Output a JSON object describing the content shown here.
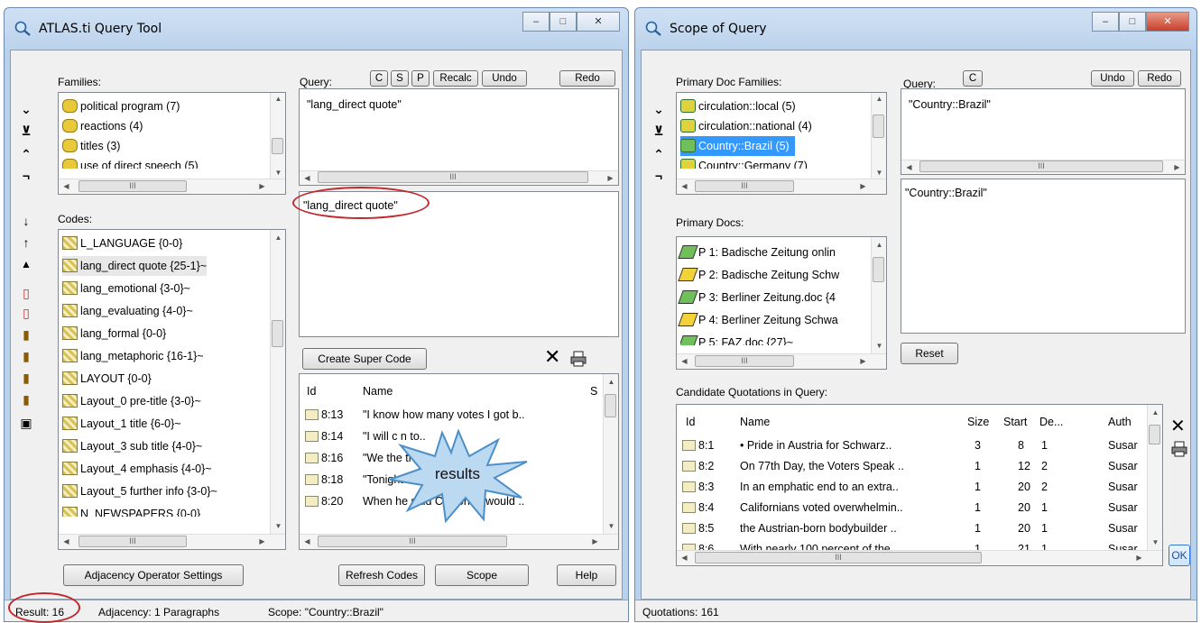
{
  "left_window": {
    "title": "ATLAS.ti Query Tool",
    "families_label": "Families:",
    "families": [
      "political program (7)",
      "reactions (4)",
      "titles (3)",
      "use of direct speech (5)"
    ],
    "codes_label": "Codes:",
    "codes": [
      "L_LANGUAGE {0-0}",
      "lang_direct quote {25-1}~",
      "lang_emotional {3-0}~",
      "lang_evaluating {4-0}~",
      "lang_formal {0-0}",
      "lang_metaphoric {16-1}~",
      "LAYOUT {0-0}",
      "Layout_0 pre-title {3-0}~",
      "Layout_1 title {6-0}~",
      "Layout_3 sub title {4-0}~",
      "Layout_4 emphasis {4-0}~",
      "Layout_5 further info {3-0}~",
      "N_NEWSPAPERS {0-0}"
    ],
    "query_label": "Query:",
    "query_buttons": [
      "C",
      "S",
      "P",
      "Recalc",
      "Undo",
      "Redo"
    ],
    "query_text": "\"lang_direct quote\"",
    "query_stack_text": "\"lang_direct quote\"",
    "create_super_code": "Create Super Code",
    "results_columns": [
      "Id",
      "Name",
      "S"
    ],
    "results": [
      {
        "id": "8:13",
        "name": "\"I know how many votes I got b.."
      },
      {
        "id": "8:14",
        "name": "\"I will c                      n to.."
      },
      {
        "id": "8:16",
        "name": "\"We                          the tru.."
      },
      {
        "id": "8:18",
        "name": "\"Tonight t               ecided it.."
      },
      {
        "id": "8:20",
        "name": "When he said California would .."
      }
    ],
    "callout": "results",
    "buttons": {
      "adjacency": "Adjacency Operator Settings",
      "refresh": "Refresh Codes",
      "scope": "Scope",
      "help": "Help"
    },
    "status": {
      "result": "Result: 16",
      "adjacency": "Adjacency: 1 Paragraphs",
      "scope": "Scope: \"Country::Brazil\""
    }
  },
  "right_window": {
    "title": "Scope of Query",
    "pd_families_label": "Primary Doc Families:",
    "pd_families": [
      "circulation::local (5)",
      "circulation::national (4)",
      "Country::Brazil (5)",
      "Country::Germany (7)"
    ],
    "primary_docs_label": "Primary Docs:",
    "primary_docs": [
      "P 1: Badische Zeitung onlin",
      "P 2: Badische Zeitung Schw",
      "P 3: Berliner Zeitung.doc {4",
      "P 4: Berliner Zeitung Schwa",
      "P 5: FAZ.doc {27}~"
    ],
    "query_label": "Query:",
    "query_buttons": [
      "C",
      "Undo",
      "Redo"
    ],
    "query_text": "\"Country::Brazil\"",
    "query_stack_text": "\"Country::Brazil\"",
    "reset": "Reset",
    "candidate_label": "Candidate Quotations in Query:",
    "columns": [
      "Id",
      "Name",
      "Size",
      "Start",
      "De...",
      "Auth"
    ],
    "quotations": [
      {
        "id": "8:1",
        "name": "• Pride in Austria for Schwarz..",
        "size": "3",
        "start": "8",
        "de": "1",
        "auth": "Susar"
      },
      {
        "id": "8:2",
        "name": "On 77th Day, the Voters Speak ..",
        "size": "1",
        "start": "12",
        "de": "2",
        "auth": "Susar"
      },
      {
        "id": "8:3",
        "name": "In an emphatic end to an extra..",
        "size": "1",
        "start": "20",
        "de": "2",
        "auth": "Susar"
      },
      {
        "id": "8:4",
        "name": "Californians voted overwhelmin..",
        "size": "1",
        "start": "20",
        "de": "1",
        "auth": "Susar"
      },
      {
        "id": "8:5",
        "name": "the Austrian-born bodybuilder ..",
        "size": "1",
        "start": "20",
        "de": "1",
        "auth": "Susar"
      },
      {
        "id": "8:6",
        "name": "With nearly 100 percent of the..",
        "size": "1",
        "start": "21",
        "de": "1",
        "auth": "Susar"
      }
    ],
    "ok": "OK",
    "status": "Quotations: 161"
  },
  "colors": {
    "selection": "#3399ff",
    "annotation": "#c0282c",
    "frame": "#b9d1ea"
  }
}
